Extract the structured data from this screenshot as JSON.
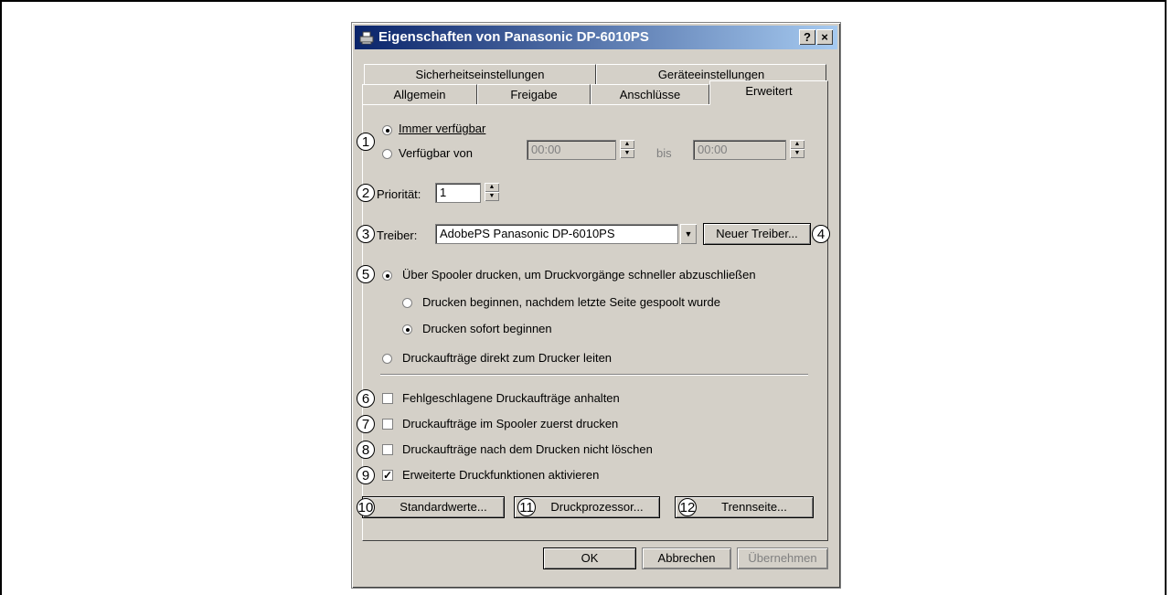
{
  "window": {
    "title": "Eigenschaften von Panasonic DP-6010PS",
    "help_button": "?",
    "close_button": "×",
    "icon": "printer-icon"
  },
  "tabs": {
    "row1": [
      "Sicherheitseinstellungen",
      "Geräteeinstellungen"
    ],
    "row2": [
      "Allgemein",
      "Freigabe",
      "Anschlüsse",
      "Erweitert"
    ],
    "selected": "Erweitert"
  },
  "availability": {
    "always_label": "Immer verfügbar",
    "from_label": "Verfügbar von",
    "from_time": "00:00",
    "to_label": "bis",
    "to_time": "00:00",
    "selected": "always"
  },
  "priority": {
    "label": "Priorität:",
    "value": "1"
  },
  "driver": {
    "label": "Treiber:",
    "value": "AdobePS Panasonic DP-6010PS",
    "new_driver_button": "Neuer Treiber..."
  },
  "spooling": {
    "spool_label": "Über Spooler drucken, um Druckvorgänge schneller abzuschließen",
    "after_last_page_label": "Drucken beginnen, nachdem letzte Seite gespoolt wurde",
    "immediately_label": "Drucken sofort beginnen",
    "direct_label": "Druckaufträge direkt zum Drucker leiten"
  },
  "options": {
    "hold_mismatched": {
      "label": "Fehlgeschlagene Druckaufträge anhalten",
      "checked": false
    },
    "print_spooled_first": {
      "label": "Druckaufträge im Spooler zuerst drucken",
      "checked": false
    },
    "keep_printed": {
      "label": "Druckaufträge nach dem Drucken nicht löschen",
      "checked": false
    },
    "advanced_features": {
      "label": "Erweiterte Druckfunktionen aktivieren",
      "checked": true
    },
    "check_mark": "✓"
  },
  "buttons": {
    "defaults": "Standardwerte...",
    "processor": "Druckprozessor...",
    "separator": "Trennseite...",
    "ok": "OK",
    "cancel": "Abbrechen",
    "apply": "Übernehmen"
  },
  "callouts": [
    "1",
    "2",
    "3",
    "4",
    "5",
    "6",
    "7",
    "8",
    "9",
    "10",
    "11",
    "12"
  ]
}
